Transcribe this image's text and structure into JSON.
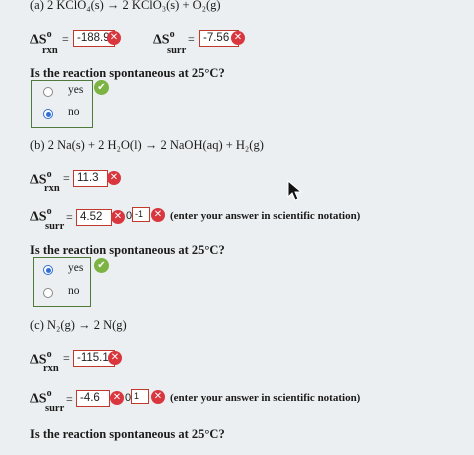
{
  "part_a": {
    "equation": "(a) 2 KClO₄(s) → 2 KClO₃(s) + O₂(g)",
    "delta_s_symbol": "ΔS",
    "degree": "o",
    "sub_rxn": "rxn",
    "sub_surr": "surr",
    "equals": "=",
    "rxn_value": "-188.9",
    "surr_value": "-7.56",
    "question": "Is the reaction spontaneous at 25°C?",
    "options": [
      "yes",
      "no"
    ],
    "selected": "no"
  },
  "part_b": {
    "equation": "(b) 2 Na(s) + 2 H₂O(l) → 2 NaOH(aq) + H₂(g)",
    "rxn_value": "11.3",
    "surr_value": "4.52",
    "surr_exponent": "-1",
    "note": "(enter your answer in scientific notation)",
    "question": "Is the reaction spontaneous at 25°C?",
    "options": [
      "yes",
      "no"
    ],
    "selected": "yes"
  },
  "part_c": {
    "equation": "(c) N₂(g) → 2 N(g)",
    "rxn_value": "-115.1",
    "surr_value": "-4.6",
    "surr_exponent": "1",
    "note": "(enter your answer in scientific notation)",
    "question": "Is the reaction spontaneous at 25°C?"
  },
  "icons": {
    "incorrect": "x-circle-icon",
    "correct": "check-circle-icon",
    "cursor": "arrow-cursor-icon"
  },
  "colors": {
    "incorrect": "#d9363e",
    "correct": "#7cb342",
    "radio_selected": "#2f6fd6"
  },
  "glyphs": {
    "x": "✕",
    "check": "✔",
    "times_ten": "0"
  }
}
